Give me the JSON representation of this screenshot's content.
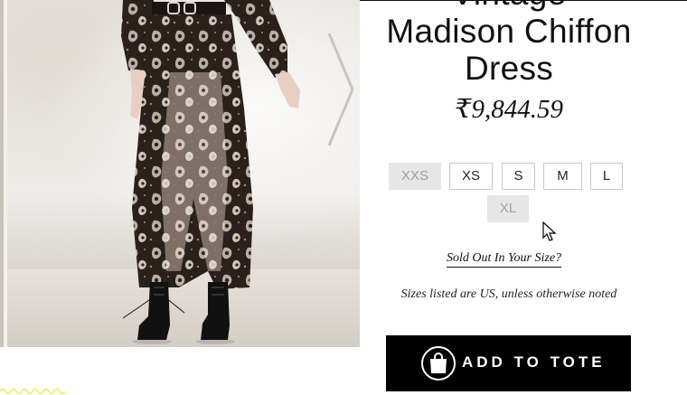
{
  "product": {
    "title_line0": "Vintage",
    "title_line1": "Madison Chiffon",
    "title_line2": "Dress",
    "price": "₹9,844.59"
  },
  "sizes": [
    {
      "label": "XXS",
      "sold_out": true
    },
    {
      "label": "XS",
      "sold_out": false
    },
    {
      "label": "S",
      "sold_out": false
    },
    {
      "label": "M",
      "sold_out": false
    },
    {
      "label": "L",
      "sold_out": false
    },
    {
      "label": "XL",
      "sold_out": true
    }
  ],
  "links": {
    "sold_out_in_size": "Sold Out In Your Size?"
  },
  "notes": {
    "sizes_note": "Sizes listed are US, unless otherwise noted"
  },
  "actions": {
    "add_to_tote": "ADD TO TOTE"
  },
  "icons": {
    "next_arrow": "chevron-right-icon",
    "bag": "shopping-bag-icon",
    "cursor": "mouse-pointer-icon"
  },
  "colors": {
    "button_bg": "#000000",
    "sold_out_bg": "#e6e6e6",
    "sold_out_text": "#a0a0a0",
    "accent_squiggle": "#f0f07a"
  }
}
